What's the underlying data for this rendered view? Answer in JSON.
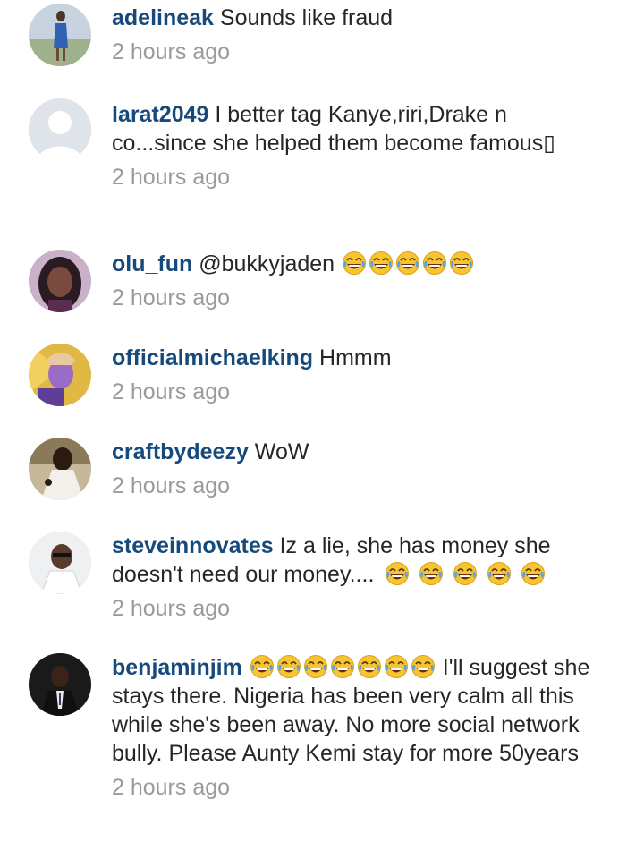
{
  "comments": [
    {
      "username": "adelineak",
      "text": " Sounds like fraud",
      "time": "2 hours ago"
    },
    {
      "username": "larat2049",
      "text": " I better tag Kanye,riri,Drake n co...since she helped them become famous▯",
      "time": "2 hours ago"
    },
    {
      "username": "olu_fun",
      "text": " @bukkyjaden ",
      "emoji": "face-with-tears-of-joy-icon",
      "emoji_count": 5,
      "time": "2 hours ago"
    },
    {
      "username": "officialmichaelking",
      "text": " Hmmm",
      "time": "2 hours ago"
    },
    {
      "username": "craftbydeezy",
      "text": " WoW",
      "time": "2 hours ago"
    },
    {
      "username": "steveinnovates",
      "text": " Iz a lie, she has money she doesn't need our money.... ",
      "emoji": "face-with-tears-of-joy-icon",
      "emoji_count": 5,
      "time": "2 hours ago"
    },
    {
      "username": "benjaminjim",
      "text_before": " ",
      "emoji": "face-with-tears-of-joy-icon",
      "emoji_count": 7,
      "text": " I'll suggest she stays there. Nigeria has been very calm all this while she's been away. No more social network bully. Please Aunty Kemi stay for more 50years",
      "time": "2 hours ago"
    }
  ],
  "colors": {
    "username": "#174a7c",
    "text": "#262626",
    "timestamp": "#9a9a9a",
    "emoji_face": "#f7c531"
  }
}
